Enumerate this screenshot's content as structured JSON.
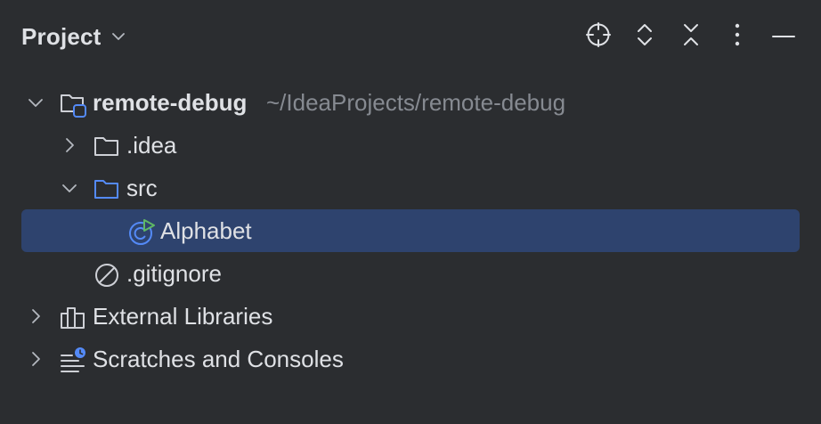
{
  "panel": {
    "title": "Project"
  },
  "toolbar": {
    "locate_icon": "crosshair-icon",
    "expand_icon": "expand-all-icon",
    "collapse_icon": "collapse-all-icon",
    "more_icon": "more-vertical-icon",
    "hide_icon": "minimize-icon"
  },
  "tree": {
    "root": {
      "label": "remote-debug",
      "path": "~/IdeaProjects/remote-debug",
      "expanded": true,
      "icon": "module-folder-icon"
    },
    "idea": {
      "label": ".idea",
      "expanded": false,
      "icon": "folder-icon"
    },
    "src": {
      "label": "src",
      "expanded": true,
      "icon": "source-folder-icon"
    },
    "alphabet": {
      "label": "Alphabet",
      "selected": true,
      "icon": "runnable-class-icon"
    },
    "gitignore": {
      "label": ".gitignore",
      "icon": "ignored-file-icon"
    },
    "external_libraries": {
      "label": "External Libraries",
      "expanded": false,
      "icon": "libraries-icon"
    },
    "scratches": {
      "label": "Scratches and Consoles",
      "expanded": false,
      "icon": "scratches-icon"
    }
  },
  "colors": {
    "background": "#2b2d30",
    "selection": "#2e436e",
    "text": "#dfe1e5",
    "muted_text": "#868a91",
    "accent_blue": "#548af7",
    "run_green": "#5fb865"
  }
}
